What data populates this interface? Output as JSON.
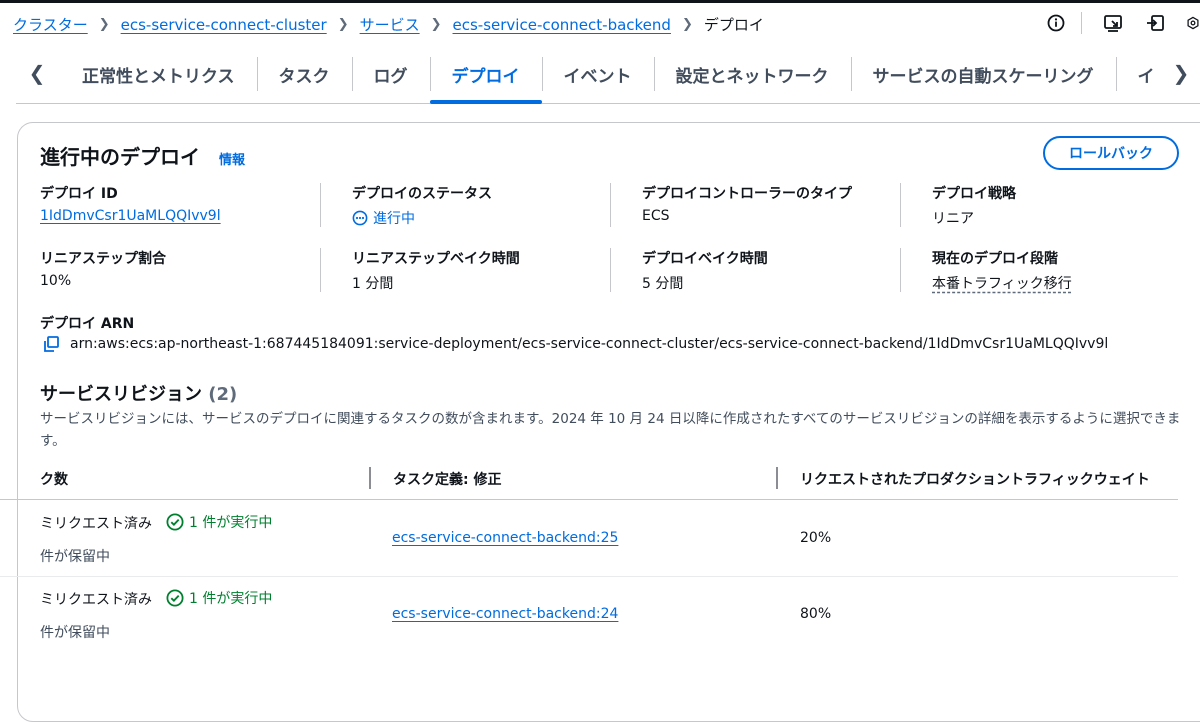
{
  "breadcrumb": [
    {
      "label": "クラスター",
      "link": true
    },
    {
      "label": "ecs-service-connect-cluster",
      "link": true
    },
    {
      "label": "サービス",
      "link": true
    },
    {
      "label": "ecs-service-connect-backend",
      "link": true
    },
    {
      "label": "デプロイ",
      "link": false
    }
  ],
  "top_icons": [
    "info-icon",
    "screenshot-icon",
    "export-icon",
    "settings-icon"
  ],
  "tabs": {
    "items": [
      "正常性とメトリクス",
      "タスク",
      "ログ",
      "デプロイ",
      "イベント",
      "設定とネットワーク",
      "サービスの自動スケーリング",
      "イ"
    ],
    "active": "デプロイ"
  },
  "panel": {
    "title": "進行中のデプロイ",
    "info": "情報",
    "rollback_label": "ロールバック",
    "fields": {
      "deploy_id": {
        "label": "デプロイ ID",
        "value": "1IdDmvCsr1UaMLQQIvv9l"
      },
      "deploy_status": {
        "label": "デプロイのステータス",
        "value": "進行中"
      },
      "controller_type": {
        "label": "デプロイコントローラーのタイプ",
        "value": "ECS"
      },
      "strategy": {
        "label": "デプロイ戦略",
        "value": "リニア"
      },
      "linear_step": {
        "label": "リニアステップ割合",
        "value": "10%"
      },
      "linear_bake": {
        "label": "リニアステップベイク時間",
        "value": "1 分間"
      },
      "deploy_bake": {
        "label": "デプロイベイク時間",
        "value": "5 分間"
      },
      "current_stage": {
        "label": "現在のデプロイ段階",
        "value": "本番トラフィック移行"
      },
      "arn": {
        "label": "デプロイ ARN",
        "value": "arn:aws:ecs:ap-northeast-1:687445184091:service-deployment/ecs-service-connect-cluster/ecs-service-connect-backend/1IdDmvCsr1UaMLQQIvv9l"
      }
    }
  },
  "revisions": {
    "title": "サービスリビジョン",
    "count": "(2)",
    "description": "サービスリビジョンには、サービスのデプロイに関連するタスクの数が含まれます。2024 年 10 月 24 日以降に作成されたすべてのサービスリビジョンの詳細を表示するように選択できます。",
    "columns": [
      "ク数",
      "タスク定義: 修正",
      "リクエストされたプロダクショントラフィックウェイト"
    ],
    "rows": [
      {
        "requested": "ミリクエスト済み",
        "running": "1 件が実行中",
        "pending": "件が保留中",
        "task_def": "ecs-service-connect-backend:25",
        "weight": "20%"
      },
      {
        "requested": "ミリクエスト済み",
        "running": "1 件が実行中",
        "pending": "件が保留中",
        "task_def": "ecs-service-connect-backend:24",
        "weight": "80%"
      }
    ]
  },
  "colors": {
    "link": "#006ce0",
    "success": "#00802f",
    "text": "#0f141a",
    "border": "#c6c6cd"
  }
}
